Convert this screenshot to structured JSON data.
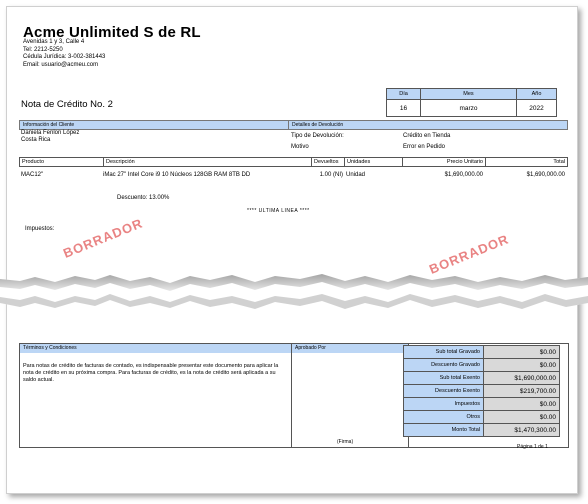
{
  "company": {
    "name": "Acme Unlimited S de RL",
    "address_lines": [
      "Avenidas 1 y 3, Calle 4",
      "Tel: 2212-5250",
      "Cédula Jurídica: 3-002-381443",
      "Email: usuario@acmeu.com"
    ]
  },
  "document": {
    "title": "Nota de Crédito No. 2"
  },
  "date": {
    "headers": [
      "Día",
      "Mes",
      "Año"
    ],
    "values": [
      "16",
      "marzo",
      "2022"
    ]
  },
  "client": {
    "header": "Información del Cliente",
    "name": "Daniela Fenlon López",
    "country": "Costa Rica"
  },
  "return_details": {
    "header": "Detalles de Devolución",
    "type_label": "Tipo de Devolución:",
    "type_value": "Crédito en Tienda",
    "reason_label": "Motivo",
    "reason_value": "Error en Pedido"
  },
  "items_header": {
    "product": "Producto",
    "description": "Descripción",
    "returned": "Devueltos",
    "units": "Unidades",
    "unit_price": "Precio Unitario",
    "total": "Total"
  },
  "items": [
    {
      "product": "MAC12\"",
      "description": "iMac 27\" Intel Core i9 10 Núcleos 128GB RAM 8TB DD",
      "returned": "1.00 (NI)",
      "units": "Unidad",
      "unit_price": "$1,690,000.00",
      "total": "$1,690,000.00"
    }
  ],
  "discount_text": "Descuento: 13.00%",
  "last_line": "**** ULTIMA LINEA ****",
  "taxes_label": "Impuestos:",
  "watermark": "BORRADOR",
  "terms": {
    "header": "Términos y Condiciones",
    "text": "Para notas de crédito de facturas de contado, es indispensable presentar este documento para aplicar la nota de crédito en su próxima compra. Para facturas de crédito, es la nota de crédito será aplicada a su saldo actual."
  },
  "approval": {
    "header": "Aprobado Por",
    "sign_label": "(Firma)"
  },
  "totals": [
    {
      "label": "Sub total Gravado",
      "value": "$0.00"
    },
    {
      "label": "Descuento Gravado",
      "value": "$0.00"
    },
    {
      "label": "Sub total Exento",
      "value": "$1,690,000.00"
    },
    {
      "label": "Descuento Exento",
      "value": "$219,700.00"
    },
    {
      "label": "Impuestos",
      "value": "$0.00"
    },
    {
      "label": "Otros",
      "value": "$0.00"
    },
    {
      "label": "Monto Total",
      "value": "$1,470,300.00"
    }
  ],
  "page_label": "Página 1 de 1"
}
